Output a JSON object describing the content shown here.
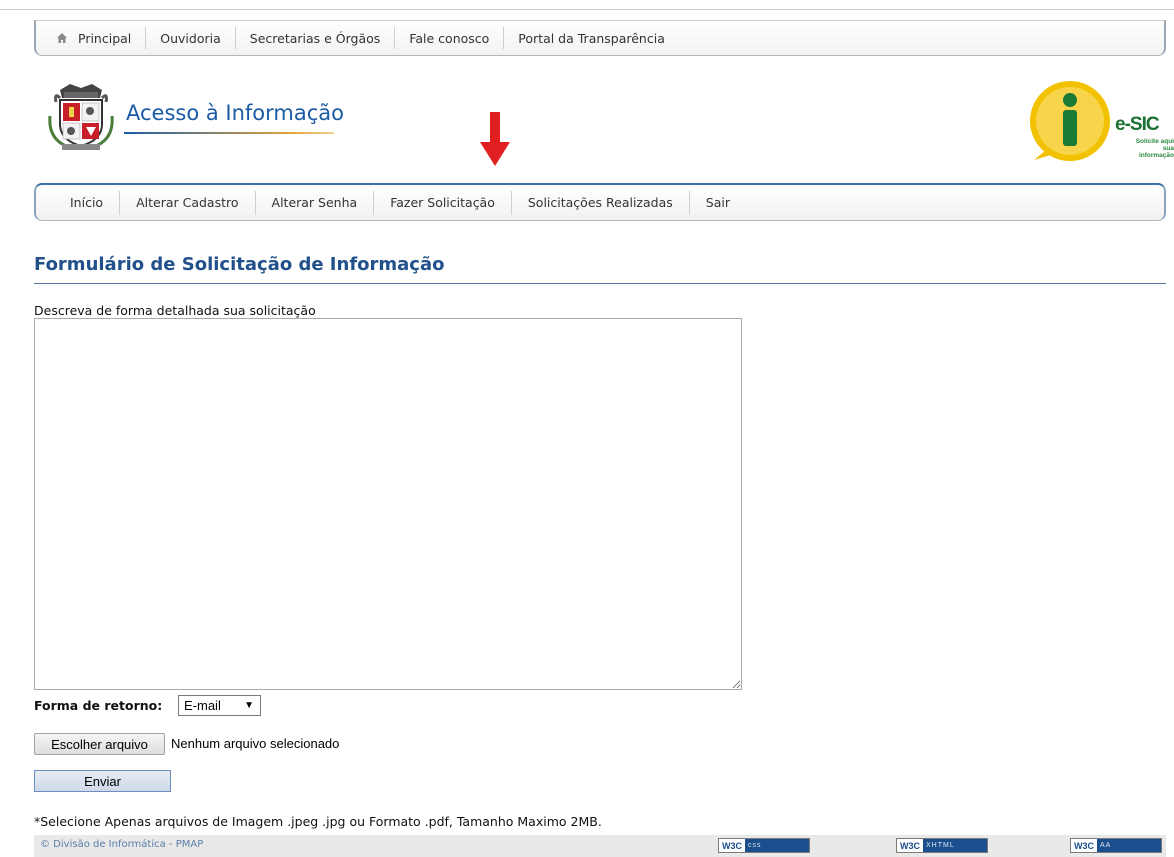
{
  "top_nav": {
    "items": [
      "Principal",
      "Ouvidoria",
      "Secretarias e Órgãos",
      "Fale conosco",
      "Portal da Transparência"
    ]
  },
  "header": {
    "title": "Acesso à Informação",
    "esic_brand": "e-SIC",
    "esic_tagline_1": "Solicite aqui",
    "esic_tagline_2": "sua informação"
  },
  "main_nav": {
    "items": [
      "Início",
      "Alterar Cadastro",
      "Alterar Senha",
      "Fazer Solicitação",
      "Solicitações Realizadas",
      "Sair"
    ]
  },
  "form": {
    "title": "Formulário de Solicitação de Informação",
    "description_label": "Descreva de forma detalhada sua solicitação",
    "description_value": "",
    "return_label": "Forma de retorno:",
    "return_selected": "E-mail",
    "file_button": "Escolher arquivo",
    "file_status": "Nenhum arquivo selecionado",
    "submit_label": "Enviar",
    "note": "*Selecione Apenas arquivos de Imagem .jpeg .jpg ou Formato .pdf, Tamanho Maximo 2MB."
  },
  "footer": {
    "credit": "© Divisão de Informática - PMAP",
    "badges": [
      {
        "w3": "W3C",
        "kind": "css"
      },
      {
        "w3": "W3C",
        "kind": "XHTML"
      },
      {
        "w3": "W3C",
        "kind": "AA"
      }
    ]
  },
  "colors": {
    "accent_blue": "#21508b",
    "arrow_red": "#e02020",
    "esic_green": "#1b6f33",
    "esic_yellow": "#f2c200"
  }
}
